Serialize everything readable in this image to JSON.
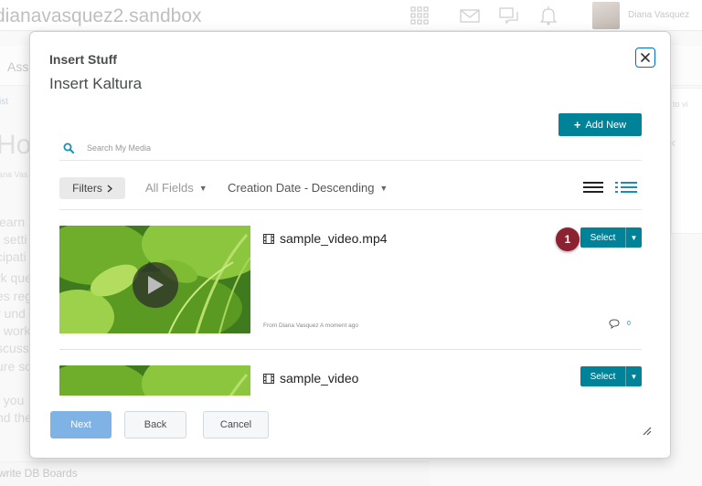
{
  "background": {
    "org_name": "dianavasquez2.sandbox",
    "user_name": "Diana Vasquez",
    "nav_text": "Ass",
    "breadcrumb": "ist",
    "right_text": "to vi",
    "heading": "How",
    "author": "iana Vas",
    "lines": [
      "learn",
      ", setti",
      "cipati",
      "rk que",
      "es reg",
      "r und",
      "t work",
      "scuss",
      "ure so",
      "t you",
      "nd the"
    ],
    "footer": "write DB Boards"
  },
  "dialog": {
    "title": "Insert Stuff",
    "subtitle": "Insert Kaltura",
    "close_label": "Close"
  },
  "toolbar": {
    "add_new": "Add New",
    "search_placeholder": "Search My Media",
    "filters": "Filters",
    "fields_filter": "All Fields",
    "sort": "Creation Date - Descending"
  },
  "entries": [
    {
      "name": "sample_video.mp4",
      "meta": "From Diana Vasquez A moment ago",
      "comments": "0",
      "select_label": "Select"
    },
    {
      "name": "sample_video",
      "select_label": "Select"
    }
  ],
  "step_badge": "1",
  "footer": {
    "next": "Next",
    "back": "Back",
    "cancel": "Cancel"
  },
  "colors": {
    "primary_teal": "#008299",
    "next_disabled": "#7fb3e6",
    "badge": "#8b2131",
    "close_border": "#006fbf"
  }
}
